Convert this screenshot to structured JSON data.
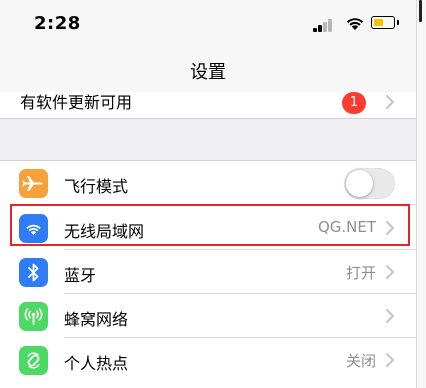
{
  "status_bar": {
    "time": "2:28",
    "battery_level": 0.55,
    "battery_color": "#f2c500",
    "icons": [
      "cellular-signal-icon",
      "wifi-icon",
      "battery-icon"
    ]
  },
  "nav": {
    "title": "设置"
  },
  "update_row": {
    "label": "有软件更新可用",
    "badge_count": "1",
    "badge_color": "#ff3b30"
  },
  "settings": {
    "airplane": {
      "label": "飞行模式",
      "icon": "airplane-icon",
      "icon_color": "#f7a13a",
      "toggle_on": false
    },
    "wifi": {
      "label": "无线局域网",
      "value": "QG.NET",
      "icon": "wifi-icon",
      "icon_color": "#2f7cf6",
      "highlighted": true
    },
    "bluetooth": {
      "label": "蓝牙",
      "value": "打开",
      "icon": "bluetooth-icon",
      "icon_color": "#2f7cf6"
    },
    "cellular": {
      "label": "蜂窝网络",
      "icon": "cellular-antenna-icon",
      "icon_color": "#4cd964"
    },
    "hotspot": {
      "label": "个人热点",
      "value": "关闭",
      "icon": "personal-hotspot-icon",
      "icon_color": "#4cd964"
    }
  },
  "highlight_color": "#e8232b"
}
